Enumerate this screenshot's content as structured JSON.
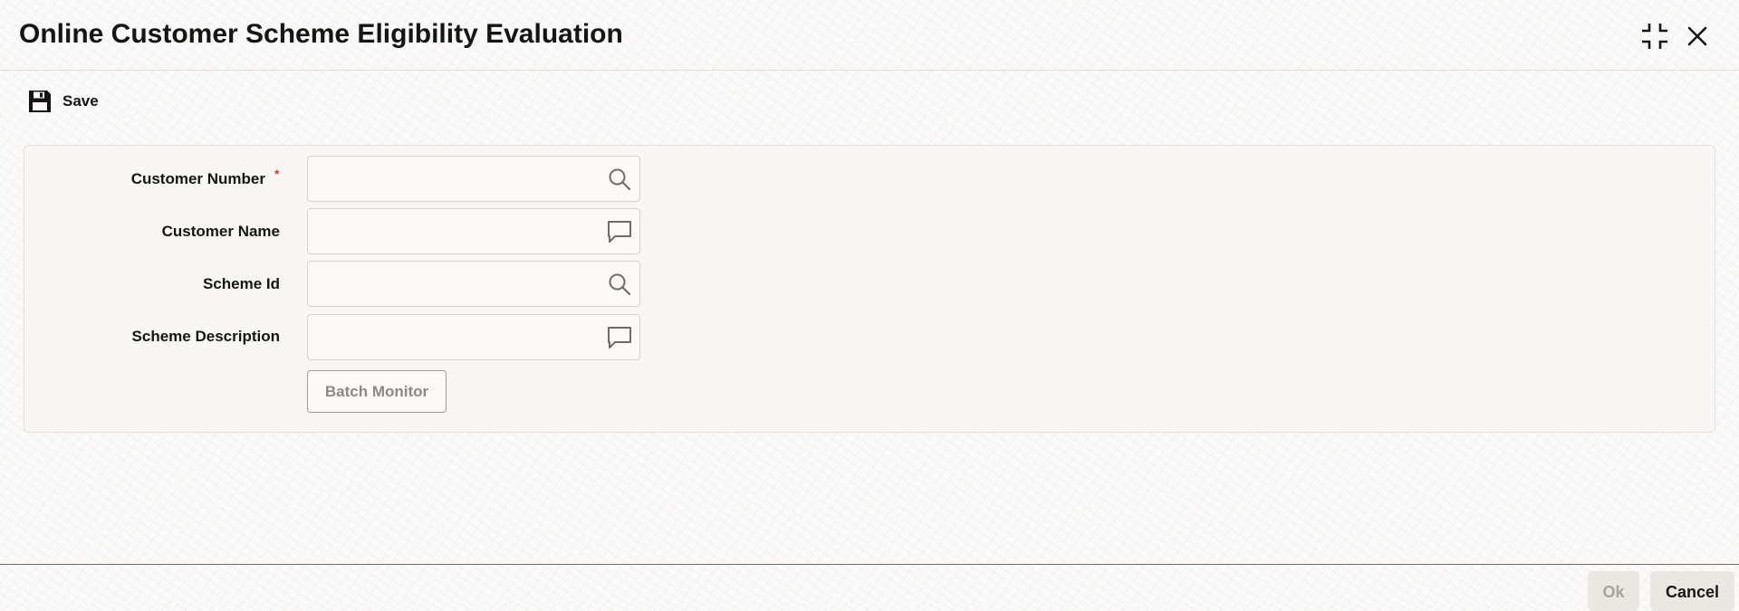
{
  "header": {
    "title": "Online Customer Scheme Eligibility Evaluation",
    "minimize_icon": "compress-icon",
    "close_icon": "close-icon"
  },
  "toolbar": {
    "save_label": "Save",
    "save_icon": "floppy-disk-icon"
  },
  "form": {
    "fields": [
      {
        "label": "Customer Number",
        "required": "*",
        "value": "",
        "icon": "search-icon"
      },
      {
        "label": "Customer Name",
        "value": "",
        "icon": "speech-bubble-icon"
      },
      {
        "label": "Scheme Id",
        "value": "",
        "icon": "search-icon"
      },
      {
        "label": "Scheme Description",
        "value": "",
        "icon": "speech-bubble-icon"
      }
    ],
    "batch_monitor_label": "Batch Monitor"
  },
  "footer": {
    "ok_label": "Ok",
    "cancel_label": "Cancel"
  },
  "colors": {
    "required": "#c74634",
    "text": "#161513",
    "icon": "#6f6c68",
    "disabled_text": "#a8a49f"
  }
}
